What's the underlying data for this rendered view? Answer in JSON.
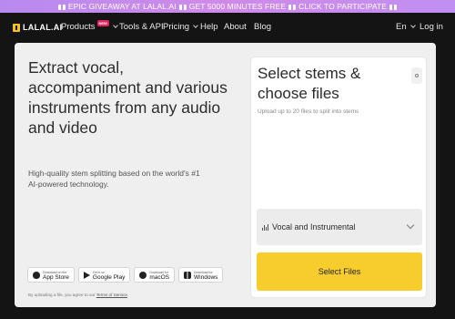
{
  "promo": {
    "text_1": "EPIC GIVEAWAY AT LALAL.AI",
    "text_2": "GET 5000 MINUTES FREE",
    "text_3": "CLICK TO PARTICIPATE",
    "icon": "gift-icon"
  },
  "nav": {
    "logo_text": "LALAL.AI",
    "items": [
      {
        "label": "Products",
        "badge": "NEW"
      },
      {
        "label": "Tools & API"
      },
      {
        "label": "Pricing"
      },
      {
        "label": "Help"
      },
      {
        "label": "About"
      },
      {
        "label": "Blog"
      }
    ],
    "language": "En",
    "login": "Log in"
  },
  "hero": {
    "headline": "Extract vocal, accompaniment and various instruments from any audio and video",
    "subtitle": "High-quality stem splitting based on the world's #1 AI-powered technology."
  },
  "stores": [
    {
      "small": "Download on the",
      "big": "App Store",
      "icon": "apple-icon"
    },
    {
      "small": "Get it on",
      "big": "Google Play",
      "icon": "play-icon"
    },
    {
      "small": "Download for",
      "big": "macOS",
      "icon": "macos-icon"
    },
    {
      "small": "Download for",
      "big": "Windows",
      "icon": "windows-icon"
    }
  ],
  "terms": {
    "prefix": "By uploading a file, you agree to our",
    "link": "Terms of Service",
    "suffix": "."
  },
  "panel": {
    "title": "Select stems & choose files",
    "subtitle": "Upload up to 20 files to split into stems",
    "stem_option": "Vocal and Instrumental",
    "button": "Select Files"
  },
  "colors": {
    "accent": "#f7cd2e",
    "banner": "#c98ded",
    "badge": "#e0245e",
    "background": "#141414"
  }
}
